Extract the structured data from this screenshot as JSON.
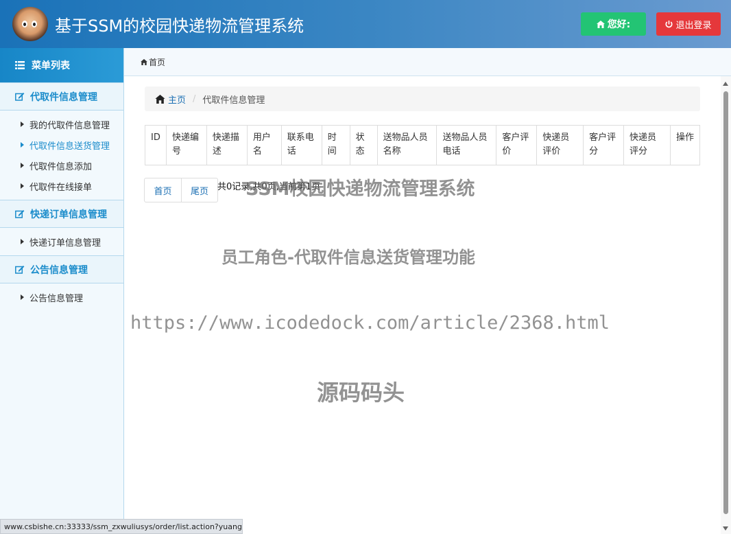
{
  "header": {
    "title": "基于SSM的校园快递物流管理系统",
    "hello_label": "您好:",
    "logout_label": "退出登录",
    "colors": {
      "hello_bg": "#23c474",
      "logout_bg": "#e5383b"
    }
  },
  "sidebar": {
    "menu_title": "菜单列表",
    "groups": [
      {
        "title": "代取件信息管理",
        "items": [
          "我的代取件信息管理",
          "代取件信息送货管理",
          "代取件信息添加",
          "代取件在线接单"
        ]
      },
      {
        "title": "快递订单信息管理",
        "items": [
          "快递订单信息管理"
        ]
      },
      {
        "title": "公告信息管理",
        "items": [
          "公告信息管理"
        ]
      }
    ],
    "active_item": "代取件信息送货管理"
  },
  "topbar": {
    "label": "首页"
  },
  "breadcrumb": {
    "home": "主页",
    "current": "代取件信息管理"
  },
  "table": {
    "columns": [
      "ID",
      "快递编号",
      "快递描述",
      "用户名",
      "联系电话",
      "时间",
      "状态",
      "送物品人员名称",
      "送物品人员电话",
      "客户评价",
      "快递员评价",
      "客户评分",
      "快递员评分",
      "操作"
    ],
    "rows": []
  },
  "pager": {
    "first": "首页",
    "last": "尾页",
    "info": "共0记录,共0页,当前第1页"
  },
  "watermarks": {
    "line1": "SSM校园快递物流管理系统",
    "line2": "员工角色-代取件信息送货管理功能",
    "line3": "https://www.icodedock.com/article/2368.html",
    "line4": "源码码头"
  },
  "statusbar": {
    "url": "www.csbishe.cn:33333/ssm_zxwuliusys/order/list.action?yuang..."
  },
  "icons": {
    "menu": "list-icon",
    "group": "edit-icon",
    "home": "home-icon",
    "hello": "home-icon",
    "logout": "power-icon"
  }
}
